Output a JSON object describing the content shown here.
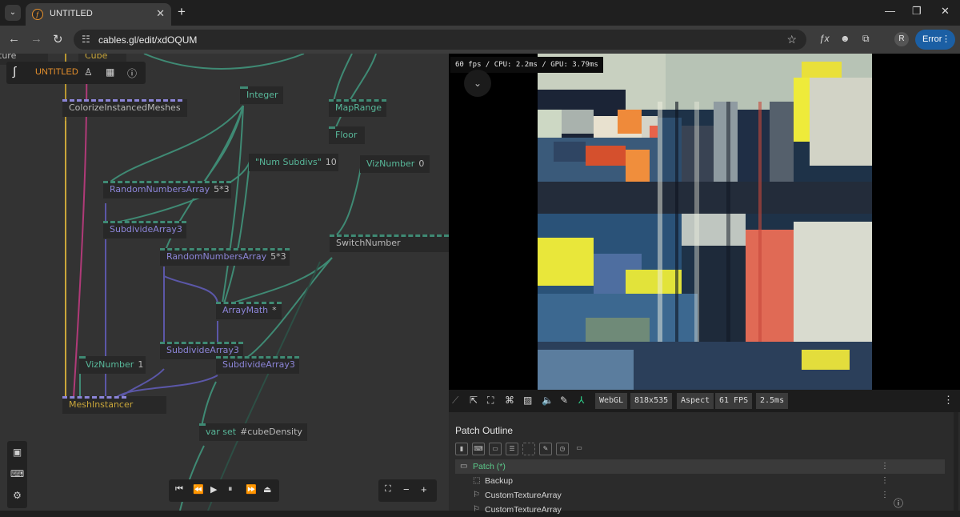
{
  "browser": {
    "tab_title": "UNTITLED",
    "favicon": "cables-logo-icon",
    "url": "cables.gl/edit/xdOQUM",
    "profile_initial": "R",
    "error_label": "Error"
  },
  "patch_toolbar": {
    "title": "UNTITLED"
  },
  "ops": {
    "cube": "Cube",
    "texture_partial": "ture",
    "colorize": "ColorizeInstancedMeshes",
    "integer": "Integer",
    "maprange": "MapRange",
    "floor": "Floor",
    "num_subdivs_name": "\"Num Subdivs\"",
    "num_subdivs_val": "10",
    "viznumber1_name": "VizNumber",
    "viznumber1_val": "0",
    "random1_name": "RandomNumbersArray",
    "random1_val": "5*3",
    "subdivide1": "SubdivideArray3",
    "switchnumber": "SwitchNumber",
    "random2_name": "RandomNumbersArray",
    "random2_val": "5*3",
    "arraymath_name": "ArrayMath",
    "arraymath_val": "*",
    "subdivide2": "SubdivideArray3",
    "subdivide3": "SubdivideArray3",
    "viznumber2_name": "VizNumber",
    "viznumber2_val": "1",
    "meshinstancer": "MeshInstancer",
    "varset_name": "var set",
    "varset_val": "#cubeDensity"
  },
  "viewer": {
    "perf_text": "60 fps / CPU: 2.2ms / GPU: 3.79ms",
    "renderer": "WebGL",
    "resolution": "818x535",
    "aspect_label": "Aspect",
    "fps": "61 FPS",
    "frame_time": "2.5ms"
  },
  "outline": {
    "title": "Patch Outline",
    "rows": [
      {
        "label": "Patch (*)",
        "icon": "folder-icon"
      },
      {
        "label": "Backup",
        "icon": "dashed-square-icon"
      },
      {
        "label": "CustomTextureArray",
        "icon": "bookmark-icon"
      },
      {
        "label": "CustomTextureArray",
        "icon": "bookmark-icon"
      }
    ]
  },
  "colors": {
    "accent_orange": "#e8912d",
    "op_teal": "#58b89a",
    "op_purple": "#8c85d8",
    "op_yellow": "#c9a63a",
    "outline_green": "#5bc98a",
    "error_blue": "#1b5fa4"
  }
}
